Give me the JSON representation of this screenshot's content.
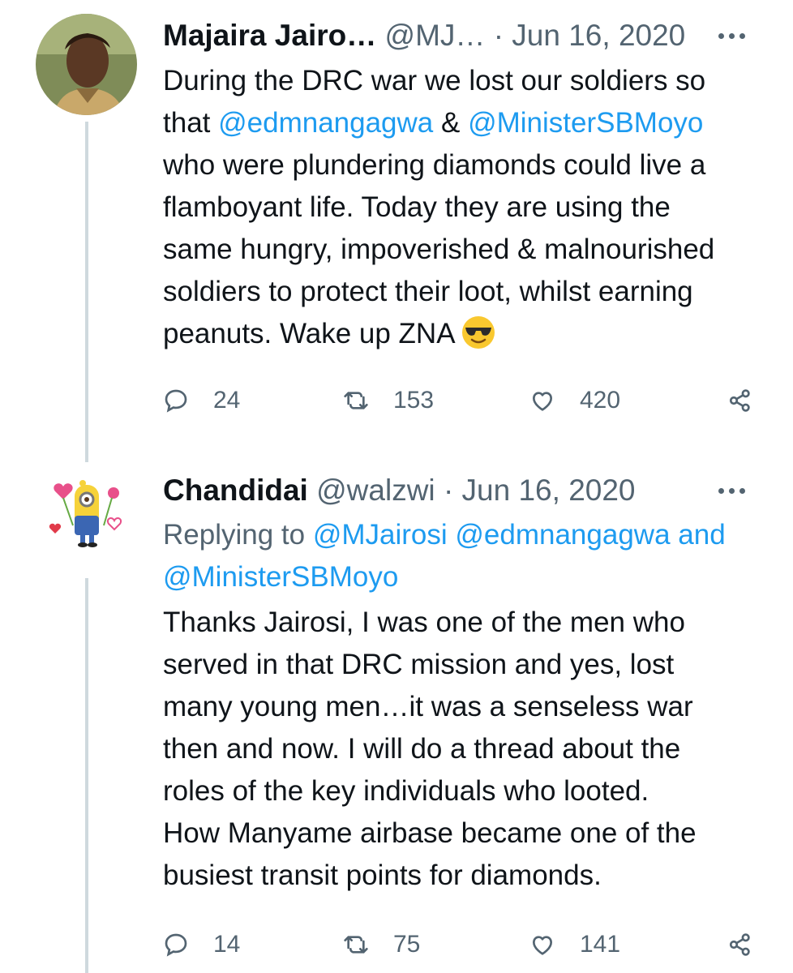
{
  "tweets": [
    {
      "author_name": "Majaira Jairo…",
      "handle": "@MJ…",
      "separator": "·",
      "date": "Jun 16, 2020",
      "body": {
        "line1": "During the DRC war we lost our soldiers so",
        "that_prefix": "that ",
        "mention1": "@edmnangagwa",
        "amp": " & ",
        "mention2": "@MinisterSBMoyo",
        "line3": "who were plundering diamonds could live a",
        "line4": "flamboyant life. Today they are using the",
        "line5": "same hungry, impoverished & malnourished",
        "line6": "soldiers to protect their loot, whilst earning",
        "line7": "peanuts. Wake up ZNA "
      },
      "emoji": "smiling-face-with-sunglasses",
      "replies": "24",
      "retweets": "153",
      "likes": "420"
    },
    {
      "author_name": "Chandidai",
      "handle": "@walzwi",
      "separator": "·",
      "date": "Jun 16, 2020",
      "replying": {
        "prefix": "Replying to ",
        "mention1": "@MJairosi",
        "mention2": "@edmnangagwa",
        "and_word": " and",
        "mention3": "@MinisterSBMoyo"
      },
      "body_lines": [
        "Thanks Jairosi, I was one of the men who",
        "served in that DRC mission and yes, lost",
        "many young men…it was a senseless war",
        "then and now. I will do a thread about the",
        "roles of the key individuals who looted.",
        "How Manyame airbase became one of the",
        "busiest transit points for diamonds."
      ],
      "replies": "14",
      "retweets": "75",
      "likes": "141"
    }
  ],
  "colors": {
    "text": "#0f1419",
    "muted": "#536471",
    "link": "#1d9bf0",
    "thread_line": "#cfd9de"
  },
  "icons": [
    "reply-icon",
    "retweet-icon",
    "like-icon",
    "share-icon",
    "more-icon"
  ]
}
